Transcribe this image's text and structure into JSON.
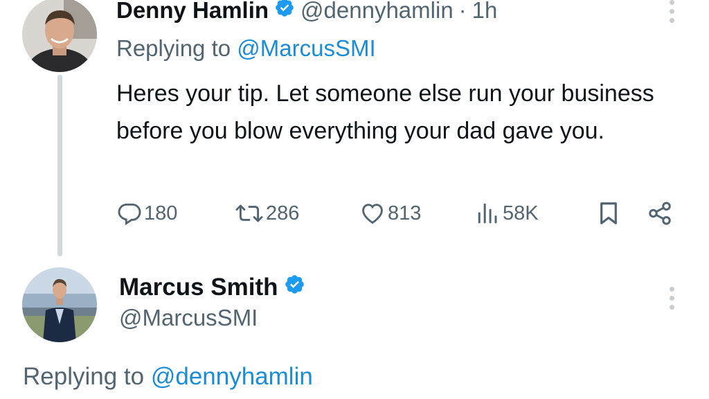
{
  "tweet1": {
    "display_name": "Denny Hamlin",
    "handle": "@dennyhamlin",
    "separator": "·",
    "time": "1h",
    "replying_prefix": "Replying to ",
    "replying_to": "@MarcusSMI",
    "text": "Heres your tip. Let someone else run your business before you blow everything your dad gave you.",
    "actions": {
      "replies": "180",
      "reposts": "286",
      "likes": "813",
      "views": "58K"
    },
    "avatar_icon": "profile-photo-denny-hamlin",
    "verified_icon": "verified-badge-icon"
  },
  "tweet2": {
    "display_name": "Marcus Smith",
    "handle": "@MarcusSMI",
    "replying_prefix": "Replying to ",
    "replying_to": "@dennyhamlin",
    "avatar_icon": "profile-photo-marcus-smith",
    "verified_icon": "verified-badge-icon"
  },
  "colors": {
    "text_primary": "#0f1419",
    "text_secondary": "#536471",
    "accent": "#1d9bf0",
    "thread_line": "#cfd9de"
  }
}
